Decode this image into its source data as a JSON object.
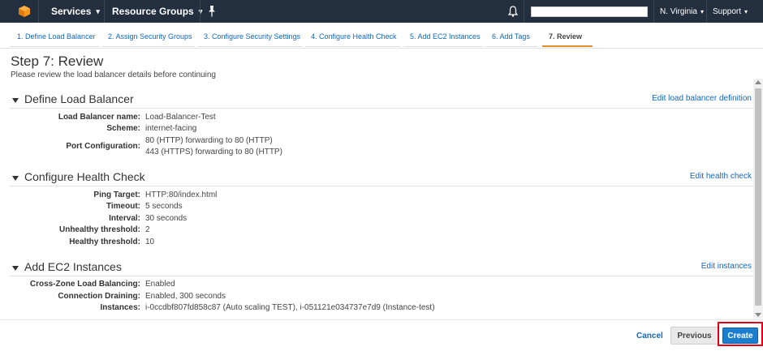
{
  "topbar": {
    "services_label": "Services",
    "resource_groups_label": "Resource Groups",
    "region_label": "N. Virginia",
    "support_label": "Support",
    "icons": [
      "aws-cube-icon",
      "pin-icon",
      "bell-icon"
    ]
  },
  "steps": [
    {
      "label": "1. Define Load Balancer"
    },
    {
      "label": "2. Assign Security Groups"
    },
    {
      "label": "3. Configure Security Settings"
    },
    {
      "label": "4. Configure Health Check"
    },
    {
      "label": "5. Add EC2 Instances"
    },
    {
      "label": "6. Add Tags"
    },
    {
      "label": "7. Review"
    }
  ],
  "page": {
    "title": "Step 7: Review",
    "subtitle": "Please review the load balancer details before continuing"
  },
  "sections": {
    "define": {
      "title": "Define Load Balancer",
      "edit": "Edit load balancer definition",
      "rows": [
        {
          "label": "Load Balancer name:",
          "value": "Load-Balancer-Test"
        },
        {
          "label": "Scheme:",
          "value": "internet-facing"
        },
        {
          "label": "Port Configuration:",
          "value": "80 (HTTP) forwarding to 80 (HTTP)",
          "value2": "443 (HTTPS) forwarding to 80 (HTTP)"
        }
      ]
    },
    "health": {
      "title": "Configure Health Check",
      "edit": "Edit health check",
      "rows": [
        {
          "label": "Ping Target:",
          "value": "HTTP:80/index.html"
        },
        {
          "label": "Timeout:",
          "value": "5 seconds"
        },
        {
          "label": "Interval:",
          "value": "30 seconds"
        },
        {
          "label": "Unhealthy threshold:",
          "value": "2"
        },
        {
          "label": "Healthy threshold:",
          "value": "10"
        }
      ]
    },
    "ec2": {
      "title": "Add EC2 Instances",
      "edit": "Edit instances",
      "rows": [
        {
          "label": "Cross-Zone Load Balancing:",
          "value": "Enabled"
        },
        {
          "label": "Connection Draining:",
          "value": "Enabled, 300 seconds"
        },
        {
          "label": "Instances:",
          "value": "i-0ccdbf807fd858c87 (Auto scaling TEST), i-051121e034737e7d9 (Instance-test)"
        }
      ]
    }
  },
  "footer": {
    "cancel_label": "Cancel",
    "previous_label": "Previous",
    "create_label": "Create"
  },
  "colors": {
    "topbar": "#232f3e",
    "link": "#1166bb",
    "active_step": "#e88b2c",
    "create_button": "#1b7ecf",
    "highlight": "#e0001a"
  }
}
